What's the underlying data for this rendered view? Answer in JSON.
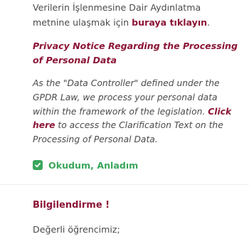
{
  "tr_notice": {
    "line1": "Verilerin İşlenmesine Dair Aydınlatma",
    "line2_prefix": "metnine ulaşmak için ",
    "link": "buraya tıklayın",
    "line2_suffix": "."
  },
  "en_title": {
    "line1": "Privacy Notice Regarding the Processing",
    "line2": "of Personal Data"
  },
  "en_body": {
    "line1": "As the \"Data Controller\" defined under the",
    "line2": "GPDR Law, we process your personal data",
    "line3_prefix": "within the framework of the legislation. ",
    "link_part1": "Click",
    "link_part2": "here",
    "line4_suffix": " to access the Clarification Text on the",
    "line5": "Processing of Personal Data."
  },
  "consent": {
    "label": "Okudum, Anladım",
    "checked": true,
    "color": "#3aa65c"
  },
  "section": {
    "heading": "Bilgilendirme !",
    "greeting": "Değerli öğrencimiz;"
  },
  "colors": {
    "accent": "#8b1536",
    "text": "#4a4a4a",
    "success": "#3aa65c"
  }
}
